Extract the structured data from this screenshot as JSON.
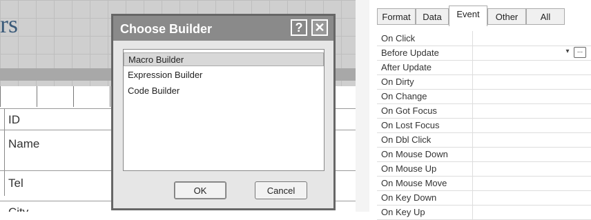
{
  "designer": {
    "title_fragment": "rs",
    "fields": [
      {
        "label": "ID"
      },
      {
        "label": "Name"
      },
      {
        "label": "Tel"
      },
      {
        "label": "City"
      }
    ]
  },
  "dialog": {
    "title": "Choose Builder",
    "help_glyph": "?",
    "close_glyph": "✕",
    "items": [
      "Macro Builder",
      "Expression Builder",
      "Code Builder"
    ],
    "selected_index": 0,
    "ok_label": "OK",
    "cancel_label": "Cancel"
  },
  "property_sheet": {
    "tabs": [
      "Format",
      "Data",
      "Event",
      "Other",
      "All"
    ],
    "active_tab": "Event",
    "rows": [
      "On Click",
      "Before Update",
      "After Update",
      "On Dirty",
      "On Change",
      "On Got Focus",
      "On Lost Focus",
      "On Dbl Click",
      "On Mouse Down",
      "On Mouse Up",
      "On Mouse Move",
      "On Key Down",
      "On Key Up"
    ],
    "dropdown_glyph": "▾",
    "builder_glyph": "..."
  }
}
